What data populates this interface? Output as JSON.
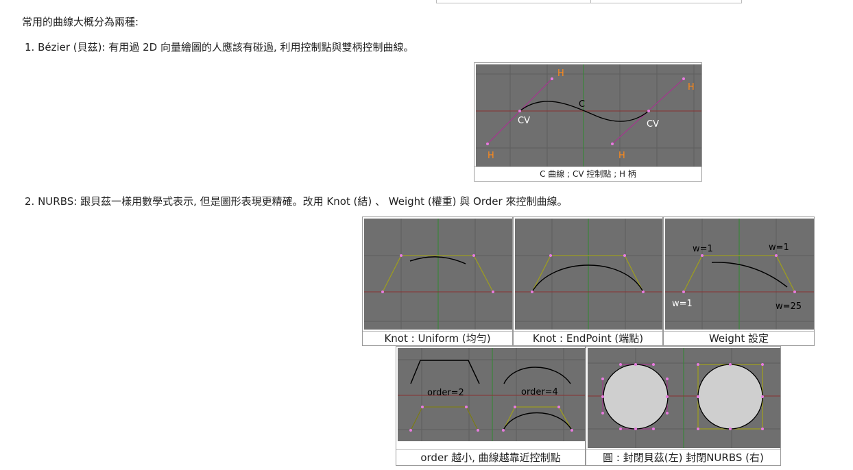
{
  "intro_text": "常用的曲線大概分為兩種:",
  "items": [
    {
      "text": "1. Bézier (貝茲): 有用過 2D 向量繪圖的人應該有碰過, 利用控制點與雙柄控制曲線。"
    },
    {
      "text": "2. NURBS: 跟貝茲一樣用數學式表示, 但是圖形表現更精確。改用 Knot (結) 、 Weight (權重) 與 Order 來控制曲線。"
    }
  ],
  "figures": {
    "bezier": {
      "caption": "C 曲線 ; CV 控制點 ; H 柄",
      "labels": {
        "h": "H",
        "c": "C",
        "cv": "CV"
      }
    },
    "knot_uniform": {
      "caption": "Knot : Uniform (均勻)"
    },
    "knot_endpoint": {
      "caption": "Knot : EndPoint (端點)"
    },
    "weight": {
      "caption": "Weight 設定",
      "labels": {
        "w1": "w=1",
        "w25": "w=25"
      }
    },
    "order": {
      "caption": "order 越小, 曲線越靠近控制點",
      "labels": {
        "order2": "order=2",
        "order4": "order=4"
      }
    },
    "circle": {
      "caption": "圓 : 封閉貝茲(左) 封閉NURBS (右)"
    }
  },
  "colors": {
    "viewport_bg": "#6f6f6f",
    "grid": "#5e5e5e",
    "x_axis": "#8a3030",
    "y_axis": "#2f8a2f",
    "handle_line": "#a13a8c",
    "control_polygon": "#9c9c20",
    "point": "#e87be0",
    "curve": "#000000",
    "handle_label": "#ff8a1a",
    "label_white": "#ffffff",
    "circle_fill": "#cfcfcf"
  }
}
